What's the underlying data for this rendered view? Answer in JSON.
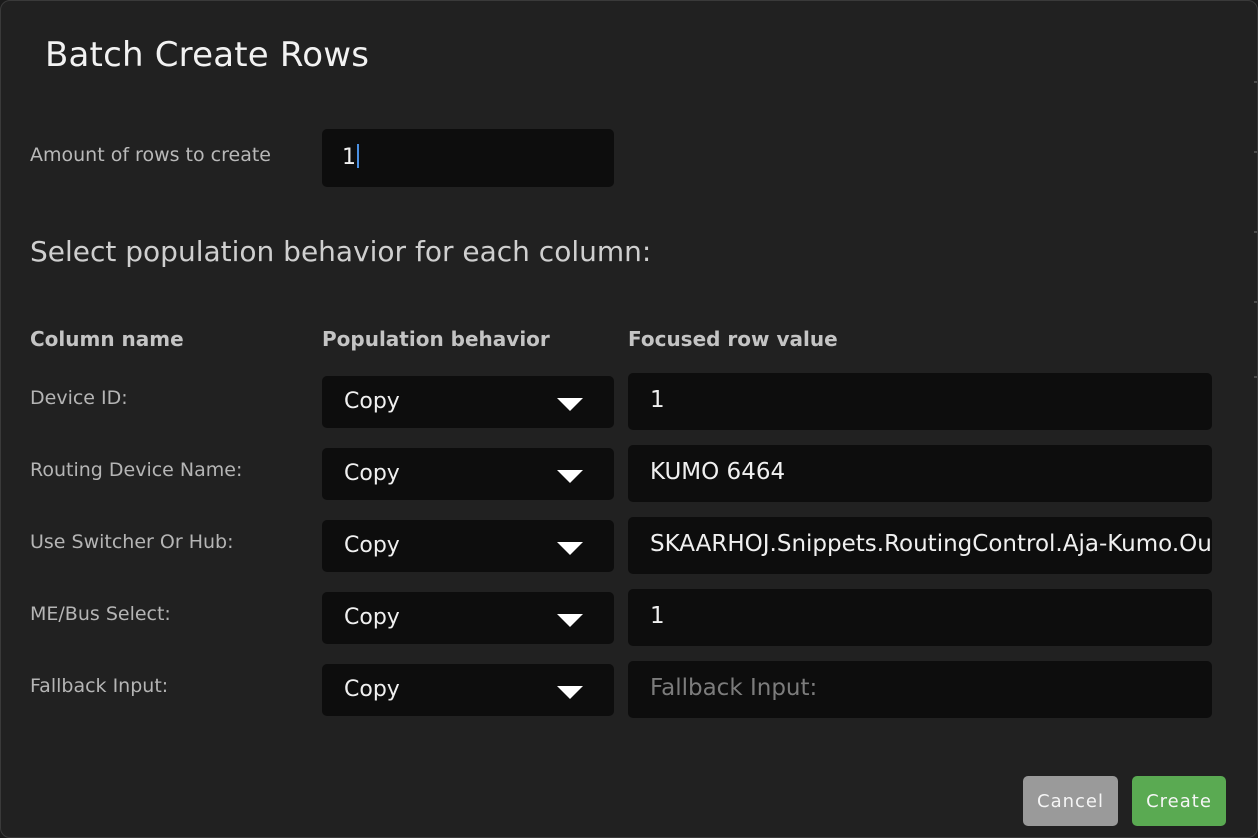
{
  "dialog": {
    "title": "Batch Create Rows"
  },
  "amount": {
    "label": "Amount of rows to create",
    "value": "1"
  },
  "section": {
    "heading": "Select population behavior for each column:"
  },
  "table": {
    "headers": {
      "column_name": "Column name",
      "population_behavior": "Population behavior",
      "focused_row_value": "Focused row value"
    },
    "rows": [
      {
        "label": "Device ID:",
        "behavior": "Copy",
        "value": "1",
        "placeholder": ""
      },
      {
        "label": "Routing Device Name:",
        "behavior": "Copy",
        "value": "KUMO 6464",
        "placeholder": ""
      },
      {
        "label": "Use Switcher Or Hub:",
        "behavior": "Copy",
        "value": "SKAARHOJ.Snippets.RoutingControl.Aja-Kumo.Out",
        "placeholder": ""
      },
      {
        "label": "ME/Bus Select:",
        "behavior": "Copy",
        "value": "1",
        "placeholder": ""
      },
      {
        "label": "Fallback Input:",
        "behavior": "Copy",
        "value": "",
        "placeholder": "Fallback Input:"
      }
    ]
  },
  "buttons": {
    "cancel": "Cancel",
    "create": "Create"
  },
  "colors": {
    "background": "#212121",
    "input_background": "#0d0d0d",
    "cancel": "#9a9a9a",
    "create": "#5aaa52",
    "caret": "#4a90e2"
  },
  "icons": {
    "dropdown": "chevron-down-icon"
  }
}
